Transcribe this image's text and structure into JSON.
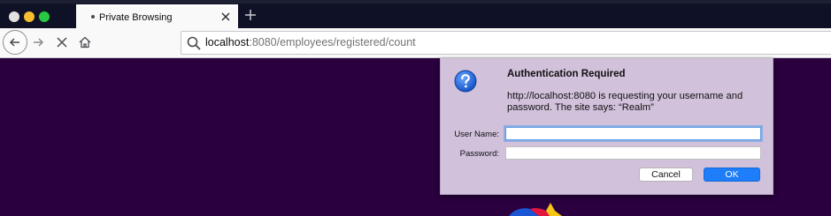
{
  "browser": {
    "tab": {
      "title": "Private Browsing"
    },
    "url": {
      "host": "localhost",
      "rest": ":8080/employees/registered/count"
    }
  },
  "dialog": {
    "title": "Authentication Required",
    "message": "http://localhost:8080 is requesting your username and password. The site says: “Realm”",
    "username_label": "User Name:",
    "password_label": "Password:",
    "username_value": "",
    "password_value": "",
    "cancel_label": "Cancel",
    "ok_label": "OK"
  },
  "colors": {
    "page_background": "#2a003f",
    "dialog_background": "#d1c1db",
    "ok_button": "#1e7df8"
  },
  "icons": [
    "close-tab-icon",
    "new-tab-icon",
    "back-icon",
    "forward-icon",
    "stop-icon",
    "home-icon",
    "search-icon",
    "question-icon"
  ]
}
